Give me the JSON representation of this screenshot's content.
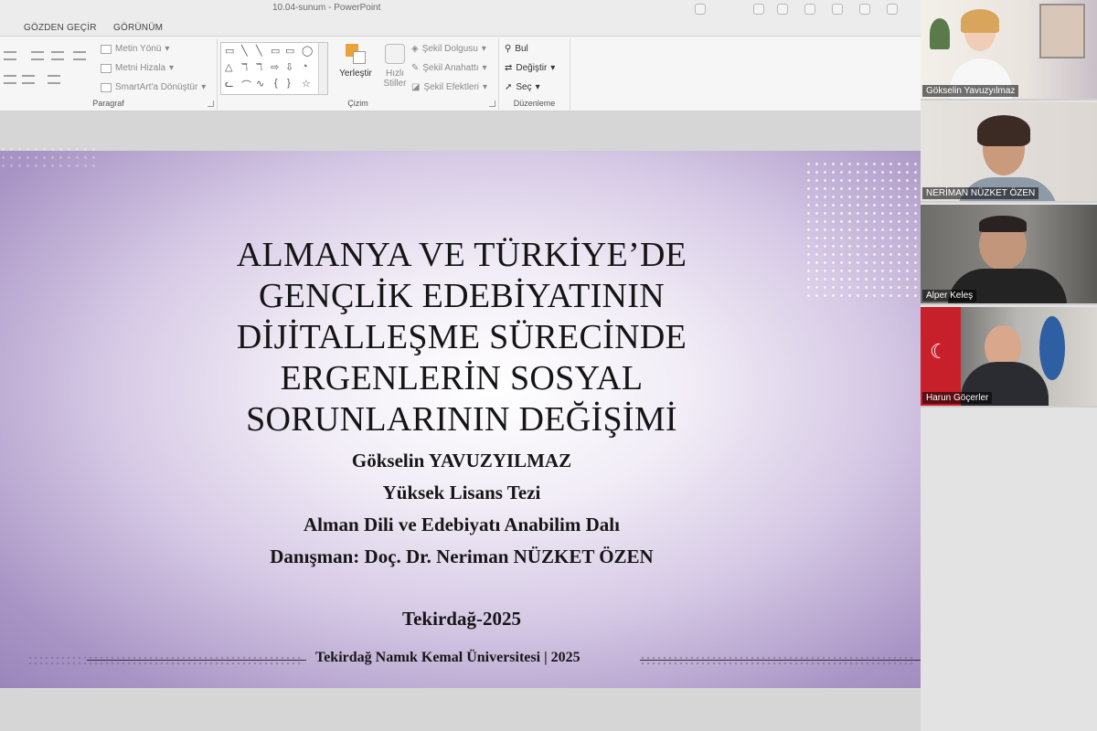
{
  "window": {
    "title": "10.04-sunum - PowerPoint"
  },
  "tabs": [
    "GÖZDEN GEÇİR",
    "GÖRÜNÜM"
  ],
  "ribbon": {
    "paragraph": {
      "label": "Paragraf",
      "metin_yonu": "Metin Yönü",
      "metni_hizala": "Metni Hizala",
      "smartart": "SmartArt'a Dönüştür"
    },
    "drawing": {
      "label": "Çizim",
      "shapes": [
        "▭",
        "╲",
        "╲",
        "▭",
        "▭",
        "◯",
        "△",
        "ℸ",
        "ℸ",
        "⇨",
        "⇩",
        "◔",
        "ᓚ",
        "⌒",
        "∿",
        "{",
        "}",
        "☆"
      ],
      "arrange": "Yerleştir",
      "quick_styles_line1": "Hızlı",
      "quick_styles_line2": "Stiller",
      "shape_fill": "Şekil Dolgusu",
      "shape_outline": "Şekil Anahattı",
      "shape_effects": "Şekil Efektleri"
    },
    "editing": {
      "label": "Düzenleme",
      "find": "Bul",
      "replace": "Değiştir",
      "select": "Seç"
    }
  },
  "slide": {
    "title_lines": [
      "ALMANYA VE TÜRKİYE’DE",
      "GENÇLİK EDEBİYATININ",
      "DİJİTALLEŞME SÜRECİNDE",
      "ERGENLERİN SOSYAL",
      "SORUNLARININ DEĞİŞİMİ"
    ],
    "author": "Gökselin YAVUZYILMAZ",
    "degree": "Yüksek Lisans Tezi",
    "department": "Alman Dili ve Edebiyatı Anabilim Dalı",
    "advisor": "Danışman: Doç. Dr. Neriman NÜZKET ÖZEN",
    "place_year": "Tekirdağ-2025",
    "footer": "Tekirdağ Namık Kemal Üniversitesi | 2025"
  },
  "participants": [
    {
      "name": "Gökselin Yavuzyılmaz"
    },
    {
      "name": "NERİMAN NÜZKET ÖZEN"
    },
    {
      "name": "Alper Keleş"
    },
    {
      "name": "Harun Göçerler"
    }
  ],
  "colors": {
    "slide_purple": "#9a86ba",
    "ribbon_bg": "#f6f6f6",
    "title_text": "#151515"
  }
}
